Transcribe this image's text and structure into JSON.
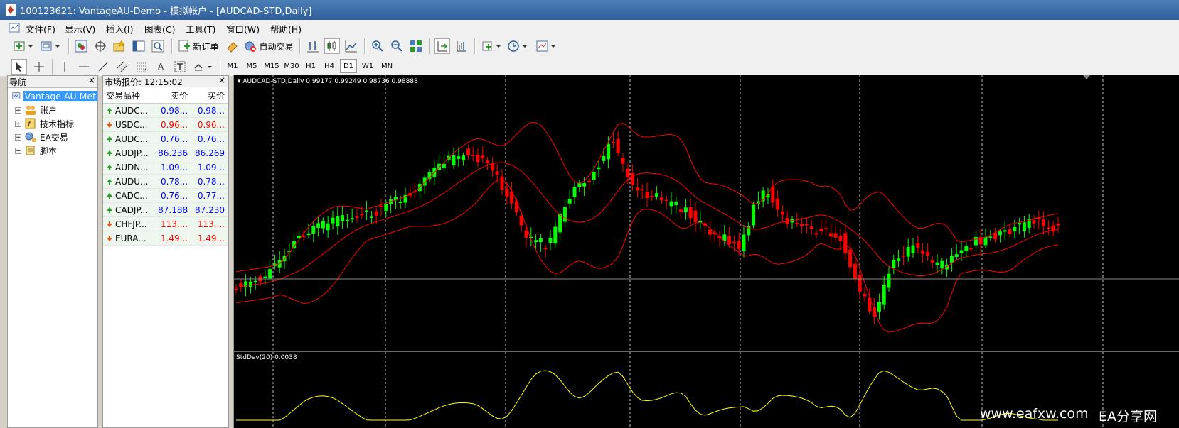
{
  "window": {
    "title": "100123621: VantageAU-Demo - 模拟帐户 - [AUDCAD-STD,Daily]"
  },
  "menu": [
    "文件(F)",
    "显示(V)",
    "插入(I)",
    "图表(C)",
    "工具(T)",
    "窗口(W)",
    "帮助(H)"
  ],
  "toolbar": {
    "new_order": "新订单",
    "auto_trading": "自动交易"
  },
  "timeframes": [
    "M1",
    "M5",
    "M15",
    "M30",
    "H1",
    "H4",
    "D1",
    "W1",
    "MN"
  ],
  "active_timeframe": "D1",
  "navigator": {
    "title": "导航",
    "root": "Vantage AU Met",
    "items": [
      "账户",
      "技术指标",
      "EA交易",
      "脚本"
    ]
  },
  "market_watch": {
    "title": "市场报价: 12:15:02",
    "headers": [
      "交易品种",
      "卖价",
      "买价"
    ],
    "rows": [
      {
        "symbol": "AUDC...",
        "bid": "0.98...",
        "ask": "0.98...",
        "dir": "up",
        "color": "#0000ff"
      },
      {
        "symbol": "USDC...",
        "bid": "0.96...",
        "ask": "0.96...",
        "dir": "down",
        "color": "#ff0000"
      },
      {
        "symbol": "AUDC...",
        "bid": "0.76...",
        "ask": "0.76...",
        "dir": "up",
        "color": "#0000ff"
      },
      {
        "symbol": "AUDJP...",
        "bid": "86.236",
        "ask": "86.269",
        "dir": "up",
        "color": "#0000ff"
      },
      {
        "symbol": "AUDN...",
        "bid": "1.09...",
        "ask": "1.09...",
        "dir": "up",
        "color": "#0000ff"
      },
      {
        "symbol": "AUDU...",
        "bid": "0.78...",
        "ask": "0.78...",
        "dir": "up",
        "color": "#0000ff"
      },
      {
        "symbol": "CADC...",
        "bid": "0.76...",
        "ask": "0.77...",
        "dir": "up",
        "color": "#0000ff"
      },
      {
        "symbol": "CADJP...",
        "bid": "87.188",
        "ask": "87.230",
        "dir": "up",
        "color": "#0000ff"
      },
      {
        "symbol": "CHFJP...",
        "bid": "113....",
        "ask": "113....",
        "dir": "down",
        "color": "#ff0000"
      },
      {
        "symbol": "EURA...",
        "bid": "1.49...",
        "ask": "1.49...",
        "dir": "down",
        "color": "#ff0000"
      }
    ]
  },
  "chart": {
    "header": "AUDCAD-STD,Daily  0.99177 0.99249 0.98736 0.98888",
    "indicator_label": "StdDev(20) 0.0038",
    "bull_color": "#00ff00",
    "bear_color": "#ff0000",
    "band_color": "#ff0000",
    "indicator_color": "#ffff00"
  },
  "watermark": {
    "site": "www.eafxw.com",
    "name": "EA分享网"
  }
}
